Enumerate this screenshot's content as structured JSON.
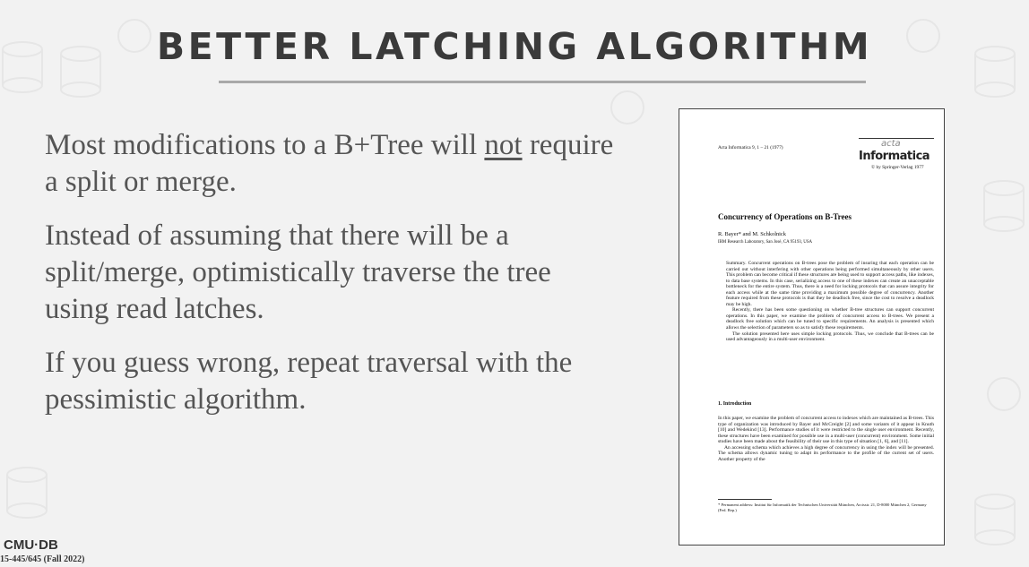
{
  "slide": {
    "title": "BETTER LATCHING ALGORITHM",
    "bullets": [
      {
        "pre": "Most modifications to a B+Tree will ",
        "underline": "not",
        "post": " require a split or merge."
      },
      {
        "text": "Instead of assuming that there will be a split/merge, optimistically traverse the tree using read latches."
      },
      {
        "text": "If you guess wrong, repeat traversal with the pessimistic algorithm."
      }
    ]
  },
  "paper": {
    "journal": "Acta Informatica 9, 1 – 21 (1977)",
    "logo_acta": "acta",
    "logo_informatica": "Informatica",
    "copyright": "© by Springer-Verlag 1977",
    "title": "Concurrency of Operations on B-Trees",
    "authors": "R. Bayer* and M. Schkolnick",
    "affiliation": "IBM Research Laboratory, San José, CA 95193, USA",
    "summary": [
      "Summary. Concurrent operations on B-trees pose the problem of insuring that each operation can be carried out without interfering with other operations being performed simultaneously by other users. This problem can become critical if these structures are being used to support access paths, like indexes, to data base systems. In this case, serializing access to one of these indexes can create an unacceptable bottleneck for the entire system. Thus, there is a need for locking protocols that can assure integrity for each access while at the same time providing a maximum possible degree of concurrency. Another feature required from these protocols is that they be deadlock free, since the cost to resolve a deadlock may be high.",
      "Recently, there has been some questioning on whether B-tree structures can support concurrent operations. In this paper, we examine the problem of concurrent access to B-trees. We present a deadlock free solution which can be tuned to specific requirements. An analysis is presented which allows the selection of parameters so as to satisfy these requirements.",
      "The solution presented here uses simple locking protocols. Thus, we conclude that B-trees can be used advantageously in a multi-user environment."
    ],
    "section_heading": "1. Introduction",
    "intro": [
      "In this paper, we examine the problem of concurrent access to indexes which are maintained as B-trees. This type of organization was introduced by Bayer and McCreight [2] and some variants of it appear in Knuth [10] and Wedekind [13]. Performance studies of it were restricted to the single user environment. Recently, these structures have been examined for possible use in a multi-user (concurrent) environment. Some initial studies have been made about the feasibility of their use in this type of situation [1, 6], and [11].",
      "An accessing schema which achieves a high degree of concurrency in using the index will be presented. The schema allows dynamic tuning to adapt its performance to the profile of the current set of users. Another property of the"
    ],
    "footnote": "* Permanent address: Institut für Informatik der Technischen Universität München, Arcisstr. 21, D-8000 München 2, Germany (Fed. Rep.)"
  },
  "footer": {
    "logo": "CMU·DB",
    "course": "15-445/645 (Fall 2022)"
  }
}
